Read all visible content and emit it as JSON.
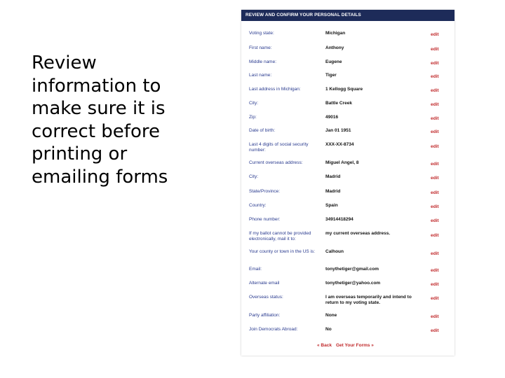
{
  "caption": "Review information to make sure it is correct before printing or emailing forms",
  "panel": {
    "title": "REVIEW AND CONFIRM YOUR PERSONAL DETAILS",
    "edit_label": "edit",
    "fields": [
      {
        "label": "Voting state:",
        "value": "Michigan"
      },
      {
        "label": "First name:",
        "value": "Anthony"
      },
      {
        "label": "Middle name:",
        "value": "Eugene"
      },
      {
        "label": "Last name:",
        "value": "Tiger"
      },
      {
        "label": "Last address in Michigan:",
        "value": "1 Kellogg Square"
      },
      {
        "label": "City:",
        "value": "Battle Creek"
      },
      {
        "label": "Zip:",
        "value": "49016"
      },
      {
        "label": "Date of birth:",
        "value": "Jan 01 1951"
      },
      {
        "label": "Last 4 digits of social security number:",
        "value": "XXX-XX-8734"
      },
      {
        "label": "Current overseas address:",
        "value": "Miguel Angel, 8"
      },
      {
        "label": "City:",
        "value": "Madrid"
      },
      {
        "label": "State/Province:",
        "value": "Madrid"
      },
      {
        "label": "Country:",
        "value": "Spain"
      },
      {
        "label": "Phone number:",
        "value": "34914418294"
      },
      {
        "label": "If my ballot cannot be provided electronically, mail it to:",
        "value": "my current overseas address."
      },
      {
        "label": "Your county or town in the US is:",
        "value": "Calhoun"
      },
      {
        "label": "Email:",
        "value": "tonythetiger@gmail.com"
      },
      {
        "label": "Alternate email",
        "value": "tonythetiger@yahoo.com"
      },
      {
        "label": "Overseas status:",
        "value": "I am overseas temporarily and intend to return to my voting state."
      },
      {
        "label": "Party affiliation:",
        "value": "None"
      },
      {
        "label": "Join Democrats Abroad:",
        "value": "No"
      }
    ],
    "back_label": "« Back",
    "forms_label": "Get Your Forms »"
  }
}
